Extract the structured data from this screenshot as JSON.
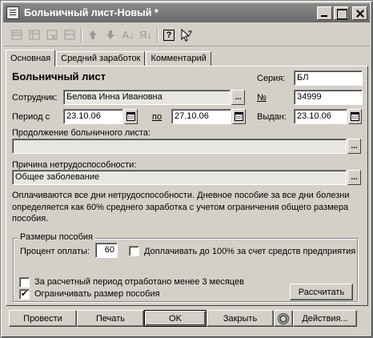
{
  "window": {
    "title": "Больничный лист-Новый *"
  },
  "toolbar": {
    "icons": [
      "new-row-icon",
      "copy-row-icon",
      "delete-row-icon",
      "edit-row-icon",
      "move-up-icon",
      "move-down-icon",
      "sort-asc-icon",
      "sort-desc-icon",
      "help-icon",
      "context-help-icon"
    ],
    "sort_asc_label": "A↓",
    "sort_desc_label": "Я↓",
    "help_label": "?"
  },
  "tabs": [
    {
      "label": "Основная"
    },
    {
      "label": "Средний заработок"
    },
    {
      "label": "Комментарий"
    }
  ],
  "form": {
    "heading": "Больничный лист",
    "employee_label": "Сотрудник:",
    "employee_value": "Белова Инна Ивановна",
    "period_label": "Период с",
    "period_from": "23.10.06",
    "period_to_label": "по",
    "period_to": "27.10.06",
    "series_label": "Серия:",
    "series_value": "БЛ",
    "number_label": "№",
    "number_value": "34999",
    "issued_label": "Выдан:",
    "issued_value": "23.10.06",
    "continuation_label": "Продолжение больничного листа:",
    "continuation_value": "",
    "reason_label": "Причина нетрудоспособности:",
    "reason_value": "Общее заболевание",
    "select_button": "...",
    "info_text": "Оплачиваются все дни нетрудоспособности. Дневное пособие за все дни болезни определяется как 60% среднего заработка с учетом ограничения общего размера пособия."
  },
  "benefits": {
    "group_title": "Размеры пособия",
    "percent_label": "Процент оплаты:",
    "percent_value": "60",
    "topup_label": "Доплачивать до 100% за счет средств предприятия",
    "topup_checked": false,
    "less_than_3m_label": "За расчетный период отработано менее 3 месяцев",
    "less_than_3m_checked": false,
    "limit_label": "Ограничивать размер пособия",
    "limit_checked": true,
    "calculate_button": "Рассчитать"
  },
  "footer": {
    "post_button": "Провести",
    "print_button": "Печать",
    "ok_button": "OK",
    "close_button": "Закрыть",
    "actions_button": "Действия..."
  }
}
